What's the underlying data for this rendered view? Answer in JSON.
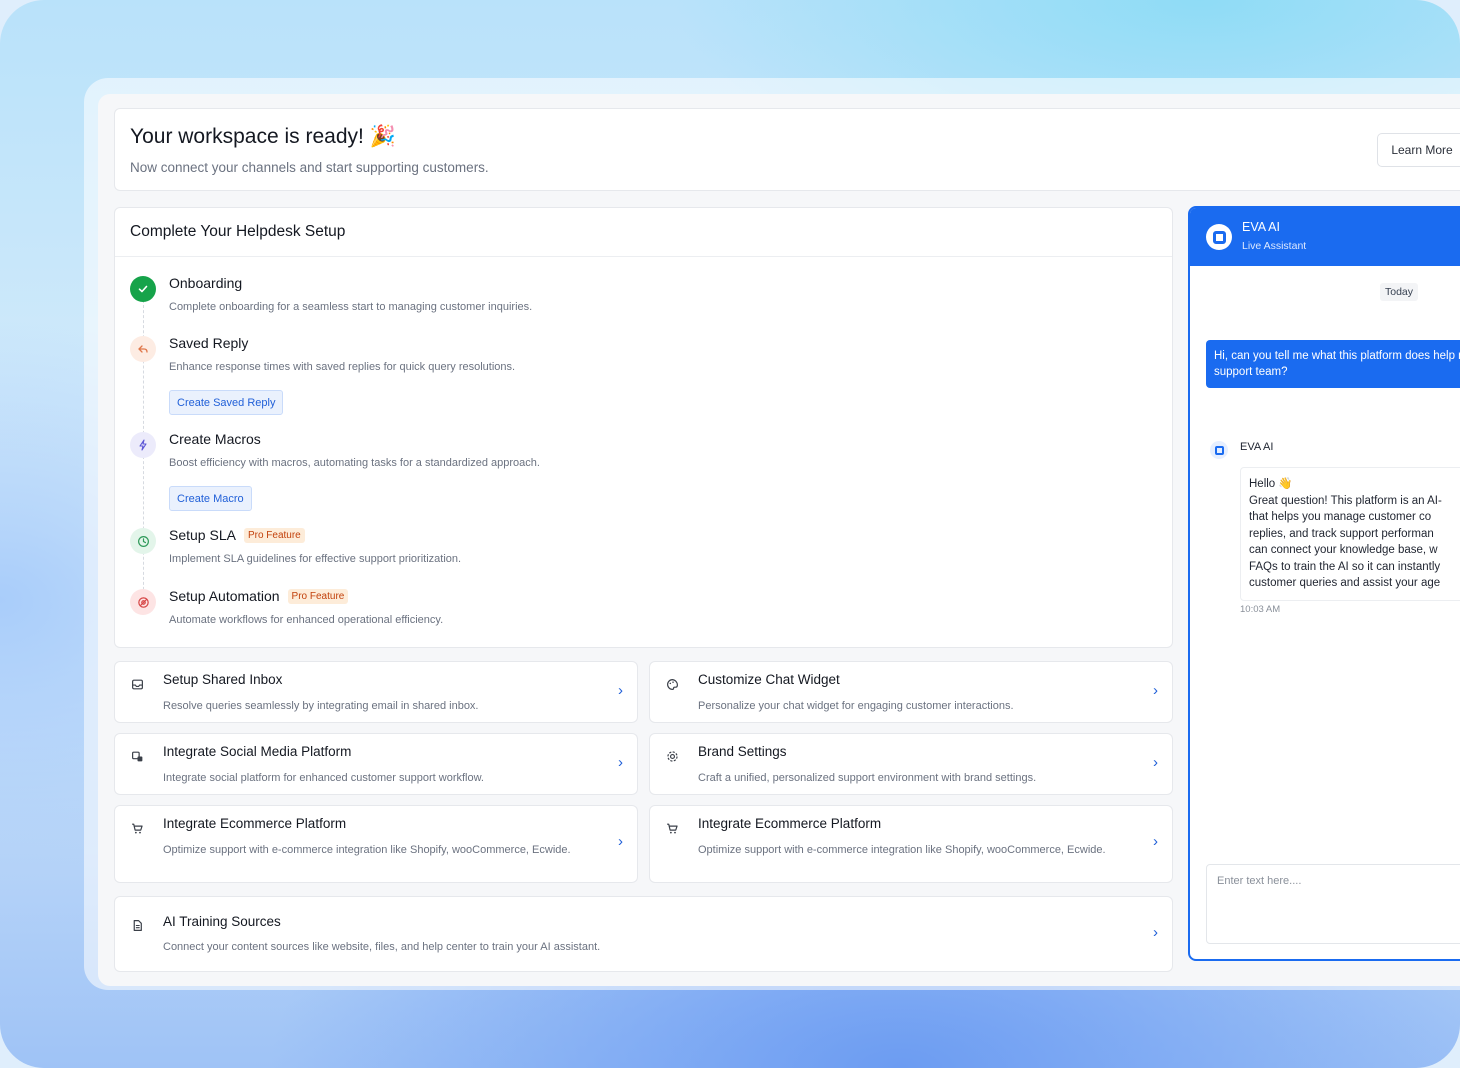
{
  "header": {
    "title": "Your workspace is ready! 🎉",
    "subtitle": "Now connect your channels and start supporting customers.",
    "learn_more_label": "Learn More"
  },
  "setup": {
    "title": "Complete Your Helpdesk Setup",
    "steps": [
      {
        "title": "Onboarding",
        "desc": "Complete onboarding for a seamless start to managing customer inquiries.",
        "icon": "check-icon",
        "status": "complete"
      },
      {
        "title": "Saved Reply",
        "desc": "Enhance response times with saved replies for quick query resolutions.",
        "icon": "reply-icon",
        "button": "Create Saved Reply"
      },
      {
        "title": "Create Macros",
        "desc": "Boost efficiency with macros, automating tasks for a standardized approach.",
        "icon": "lightning-icon",
        "button": "Create Macro"
      },
      {
        "title": "Setup SLA",
        "badge": "Pro Feature",
        "desc": "Implement SLA guidelines for effective support prioritization.",
        "icon": "clock-icon"
      },
      {
        "title": "Setup Automation",
        "badge": "Pro Feature",
        "desc": "Automate workflows for enhanced operational efficiency.",
        "icon": "automation-icon"
      }
    ]
  },
  "tiles": [
    {
      "title": "Setup Shared Inbox",
      "desc": "Resolve queries seamlessly by integrating email in shared inbox.",
      "icon": "inbox-icon"
    },
    {
      "title": "Customize Chat Widget",
      "desc": "Personalize your chat widget for engaging customer interactions.",
      "icon": "palette-icon"
    },
    {
      "title": "Integrate Social Media Platform",
      "desc": "Integrate social platform for enhanced customer support workflow.",
      "icon": "social-icon"
    },
    {
      "title": "Brand Settings",
      "desc": "Craft a unified, personalized support environment with brand settings.",
      "icon": "gear-icon"
    },
    {
      "title": "Integrate Ecommerce Platform",
      "desc": "Optimize support with e-commerce integration like Shopify, wooCommerce, Ecwide.",
      "icon": "cart-icon"
    },
    {
      "title": "Integrate Ecommerce Platform",
      "desc": "Optimize support with e-commerce integration like Shopify, wooCommerce, Ecwide.",
      "icon": "cart-icon"
    },
    {
      "title": "AI Training Sources",
      "desc": "Connect your content sources like website, files, and help center to train your AI assistant.",
      "icon": "document-icon"
    }
  ],
  "chat": {
    "name": "EVA AI",
    "status": "Live Assistant",
    "date_label": "Today",
    "user_message": "Hi, can you tell me what this platform does help my support team?",
    "bot_name": "EVA AI",
    "bot_message_lines": [
      "Hello 👋",
      "Great question! This platform is an AI-",
      "that helps you manage customer co",
      "replies, and track support performan",
      "can connect your knowledge base, w",
      "FAQs to train the AI so it can instantly",
      "customer queries and assist your age"
    ],
    "bot_time": "10:03 AM",
    "input_placeholder": "Enter text here...."
  },
  "colors": {
    "accent": "#1a6bf0",
    "success": "#16a34a",
    "pro_badge": "#c2410c"
  }
}
